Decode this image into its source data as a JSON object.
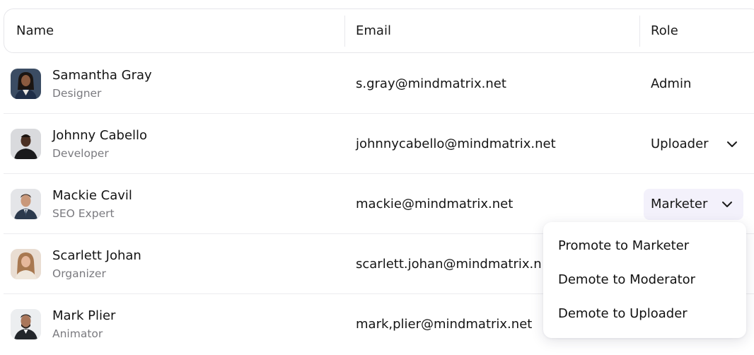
{
  "table": {
    "columns": [
      "Name",
      "Email",
      "Role"
    ],
    "rows": [
      {
        "name": "Samantha Gray",
        "title": "Designer",
        "email": "s.gray@mindmatrix.net",
        "role": "Admin"
      },
      {
        "name": "Johnny Cabello",
        "title": "Developer",
        "email": "johnnycabello@mindmatrix.net",
        "role": "Uploader"
      },
      {
        "name": "Mackie Cavil",
        "title": "SEO Expert",
        "email": "mackie@mindmatrix.net",
        "role": "Marketer"
      },
      {
        "name": "Scarlett Johan",
        "title": "Organizer",
        "email": "scarlett.johan@mindmatrix.n",
        "role": ""
      },
      {
        "name": "Mark Plier",
        "title": "Animator",
        "email": "mark,plier@mindmatrix.net",
        "role": ""
      }
    ]
  },
  "role_menu": {
    "items": [
      "Promote to Marketer",
      "Demote to Moderator",
      "Demote to Uploader"
    ]
  },
  "colors": {
    "active_select_bg": "#f3f1fb",
    "border": "#ececef",
    "muted_text": "#7a7a7f"
  },
  "icons": {
    "dropdown": "chevron-down-icon"
  }
}
